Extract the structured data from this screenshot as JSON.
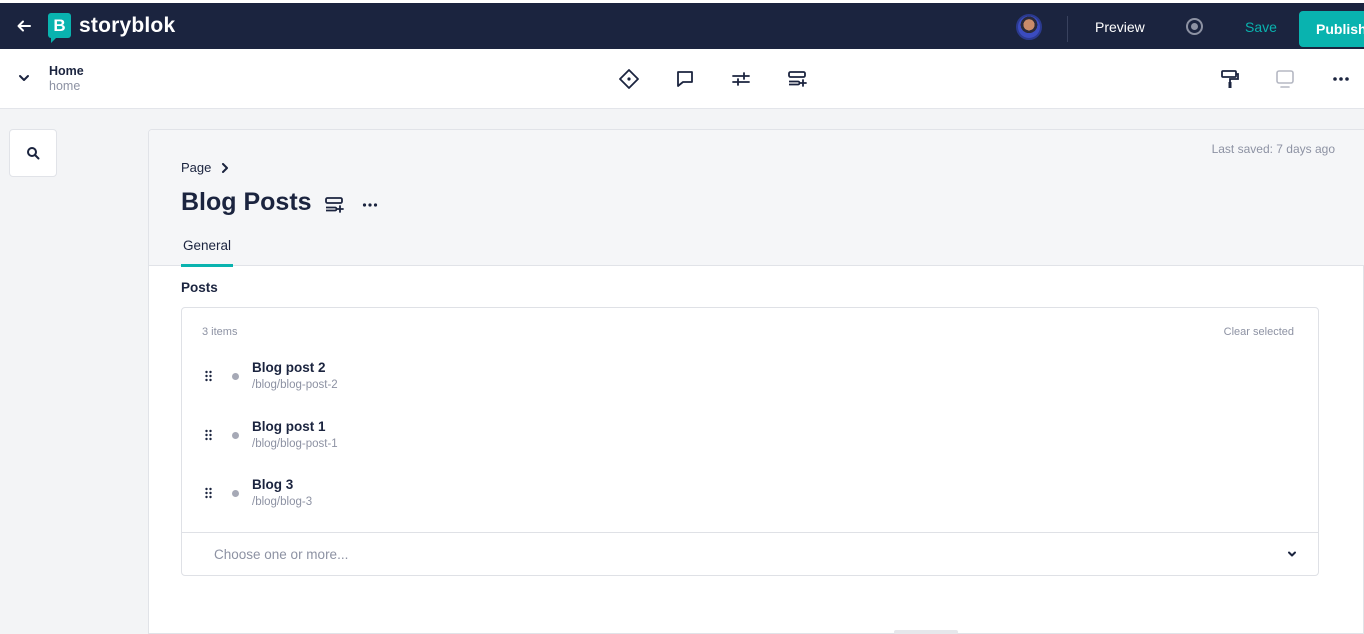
{
  "topbar": {
    "back_icon": "arrow-left-icon",
    "brand_mark": "B",
    "brand_name": "storyblok",
    "preview_label": "Preview",
    "save_label": "Save",
    "publish_label": "Publish",
    "accent_color": "#09b3af",
    "bar_color": "#1b243f"
  },
  "story": {
    "title": "Home",
    "slug": "home"
  },
  "toolbar_icons": [
    "content-diamond-icon",
    "comment-icon",
    "settings-sliders-icon",
    "add-block-icon"
  ],
  "right_icons": [
    "paint-roller-icon",
    "monitor-icon",
    "more-horizontal-icon"
  ],
  "panel": {
    "last_saved": "Last saved: 7 days ago",
    "breadcrumb": "Page",
    "title": "Blog Posts",
    "tab": "General",
    "field_label": "Posts",
    "items_count": "3 items",
    "clear_selected": "Clear selected",
    "items": [
      {
        "name": "Blog post 2",
        "slug": "/blog/blog-post-2"
      },
      {
        "name": "Blog post 1",
        "slug": "/blog/blog-post-1"
      },
      {
        "name": "Blog 3",
        "slug": "/blog/blog-3"
      }
    ],
    "select_placeholder": "Choose one or more..."
  }
}
